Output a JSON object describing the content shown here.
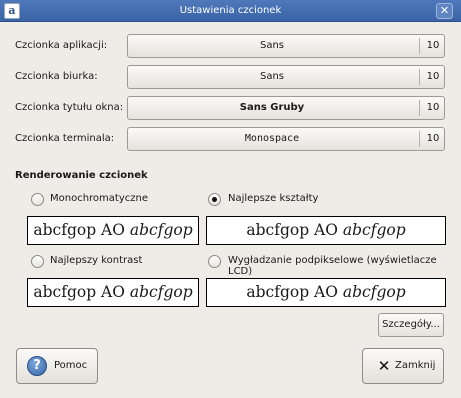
{
  "window": {
    "title": "Ustawienia czcionek",
    "app_icon_glyph": "a",
    "close_glyph": "✕"
  },
  "fonts": [
    {
      "label": "Czcionka aplikacji:",
      "font": "Sans",
      "size": "10"
    },
    {
      "label": "Czcionka biurka:",
      "font": "Sans",
      "size": "10"
    },
    {
      "label": "Czcionka tytułu okna:",
      "font": "Sans Gruby",
      "size": "10"
    },
    {
      "label": "Czcionka terminala:",
      "font": "Monospace",
      "size": "10"
    }
  ],
  "rendering": {
    "title": "Renderowanie czcionek",
    "sample_regular": "abcfgop AO ",
    "sample_italic": "abcfgop",
    "options": [
      {
        "label": "Monochromatyczne",
        "selected": false
      },
      {
        "label": "Najlepsze kształty",
        "selected": true
      },
      {
        "label": "Najlepszy kontrast",
        "selected": false
      },
      {
        "label": "Wygładzanie podpikselowe (wyświetlacze LCD)",
        "selected": false
      }
    ]
  },
  "buttons": {
    "details": "Szczegóły...",
    "help": "Pomoc",
    "close": "Zamknij",
    "help_icon_glyph": "?",
    "close_icon_glyph": "✕"
  }
}
